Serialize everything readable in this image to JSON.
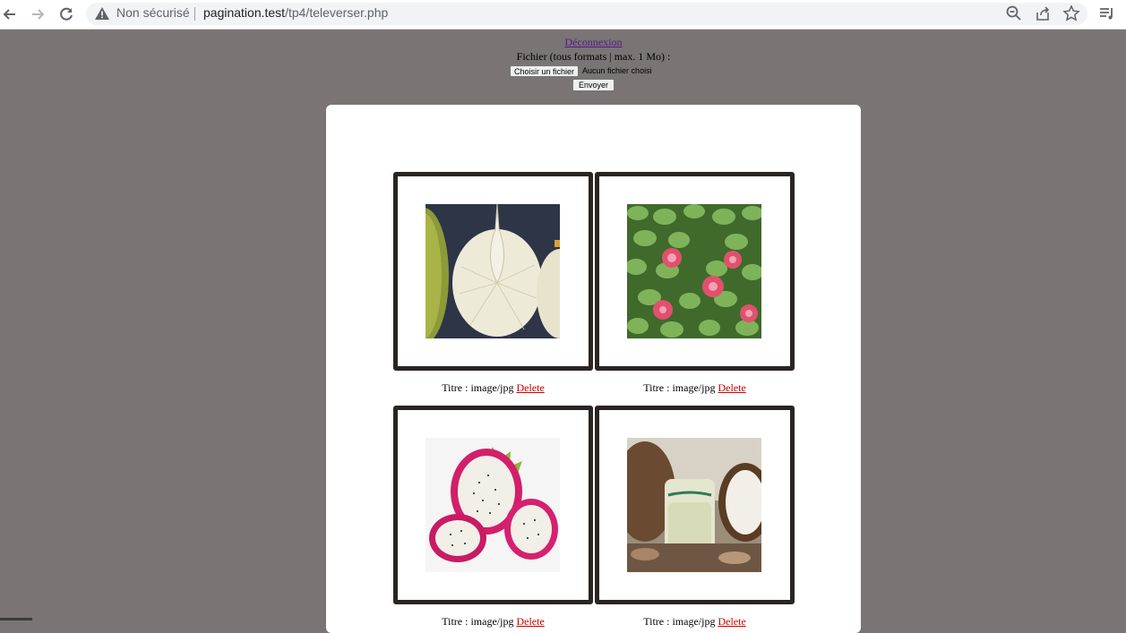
{
  "browser": {
    "security_text": "Non sécurisé",
    "url_host": "pagination.test",
    "url_path": "/tp4/televerser.php"
  },
  "header": {
    "logout_link": "Déconnexion",
    "file_label": "Fichier (tous formats | max. 1 Mo) :",
    "choose_button": "Choisir un fichier",
    "no_file_text": "Aucun fichier choisi",
    "send_button": "Envoyer"
  },
  "gallery": [
    {
      "title_prefix": "Titre : image/jpg",
      "delete_label": "Delete",
      "image": "breadfruit-photo"
    },
    {
      "title_prefix": "Titre : image/jpg",
      "delete_label": "Delete",
      "image": "guava-photo"
    },
    {
      "title_prefix": "Titre : image/jpg",
      "delete_label": "Delete",
      "image": "dragon-fruit-photo"
    },
    {
      "title_prefix": "Titre : image/jpg",
      "delete_label": "Delete",
      "image": "coconut-photo"
    }
  ]
}
